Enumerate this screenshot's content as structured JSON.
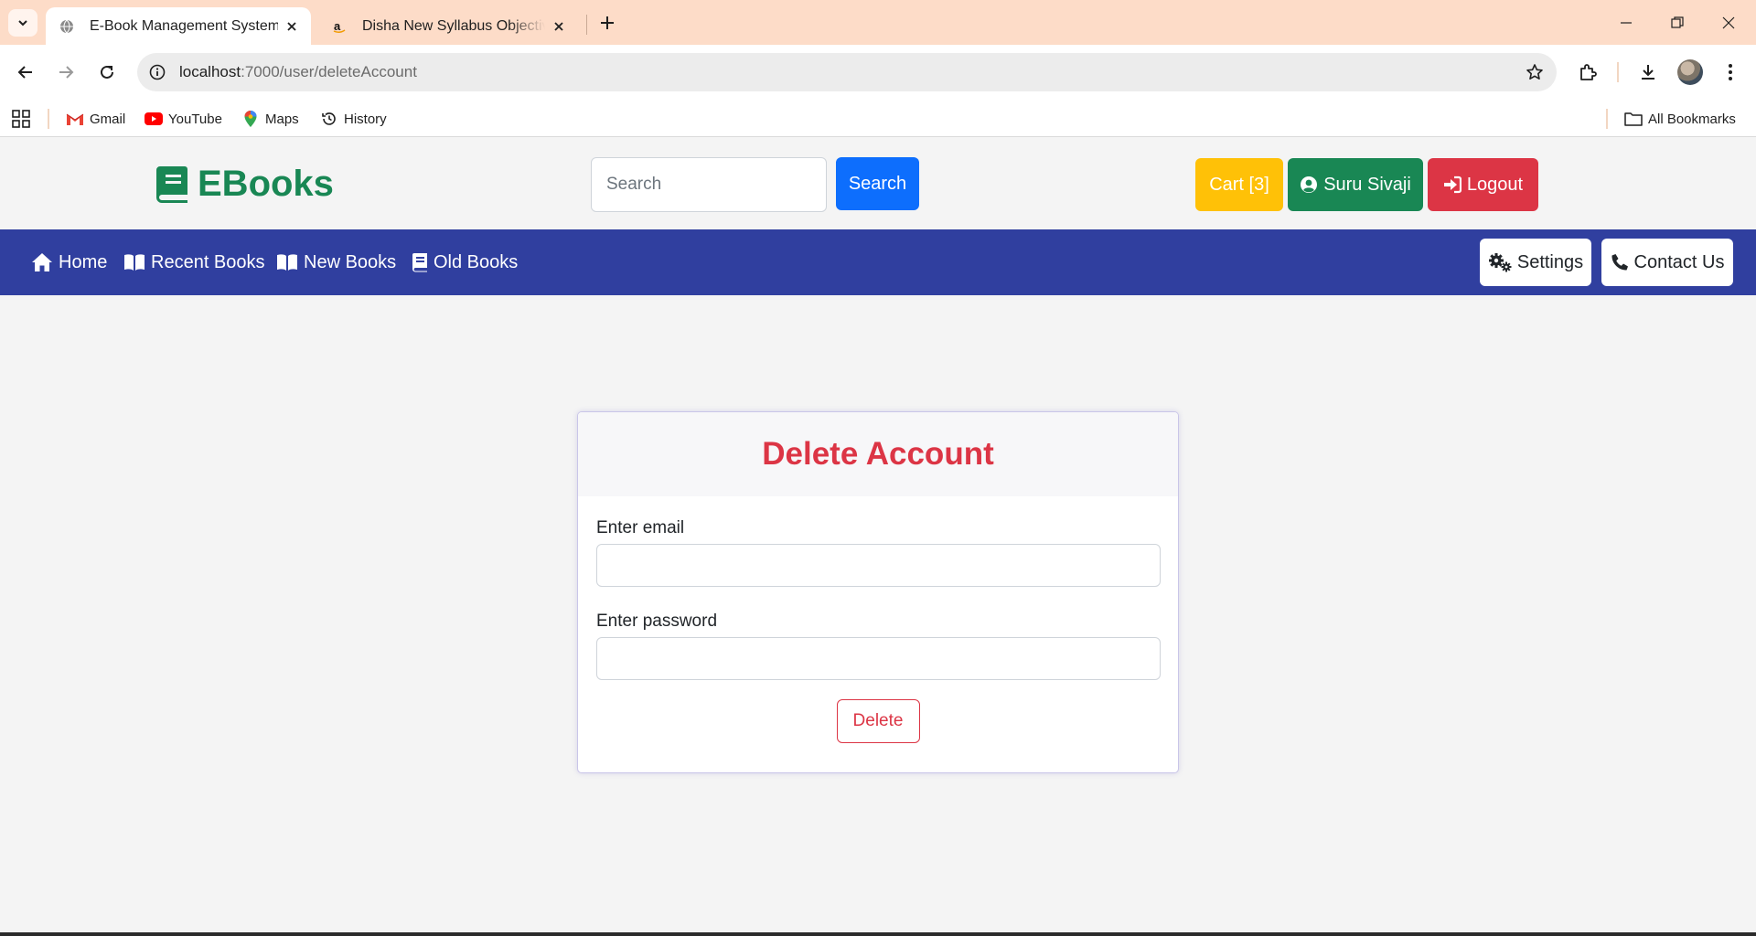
{
  "browser": {
    "tabs": [
      {
        "title": "E-Book Management System",
        "active": true
      },
      {
        "title": "Disha New Syllabus Objective NCERT",
        "active": false
      }
    ],
    "url_host": "localhost",
    "url_path": ":7000/user/deleteAccount",
    "bookmarks": [
      {
        "label": "Gmail",
        "icon": "gmail-icon"
      },
      {
        "label": "YouTube",
        "icon": "youtube-icon"
      },
      {
        "label": "Maps",
        "icon": "maps-icon"
      },
      {
        "label": "History",
        "icon": "history-icon"
      }
    ],
    "all_bookmarks_label": "All Bookmarks"
  },
  "header": {
    "brand": "EBooks",
    "search_placeholder": "Search",
    "search_button": "Search",
    "cart_label": "Cart [3]",
    "user_label": "Suru Sivaji",
    "logout_label": "Logout",
    "colors": {
      "brand": "#198754",
      "search": "#0d6efd",
      "cart": "#ffc107",
      "user": "#198754",
      "logout": "#dc3545"
    }
  },
  "nav": {
    "links": [
      {
        "label": "Home",
        "icon": "home-icon"
      },
      {
        "label": "Recent Books",
        "icon": "book-open-icon"
      },
      {
        "label": "New Books",
        "icon": "book-open-icon"
      },
      {
        "label": "Old Books",
        "icon": "book-icon"
      }
    ],
    "settings_label": "Settings",
    "contact_label": "Contact Us",
    "background": "#303f9f"
  },
  "form": {
    "title": "Delete Account",
    "email_label": "Enter email",
    "email_value": "",
    "password_label": "Enter password",
    "password_value": "",
    "submit_label": "Delete",
    "accent": "#dc3545"
  }
}
